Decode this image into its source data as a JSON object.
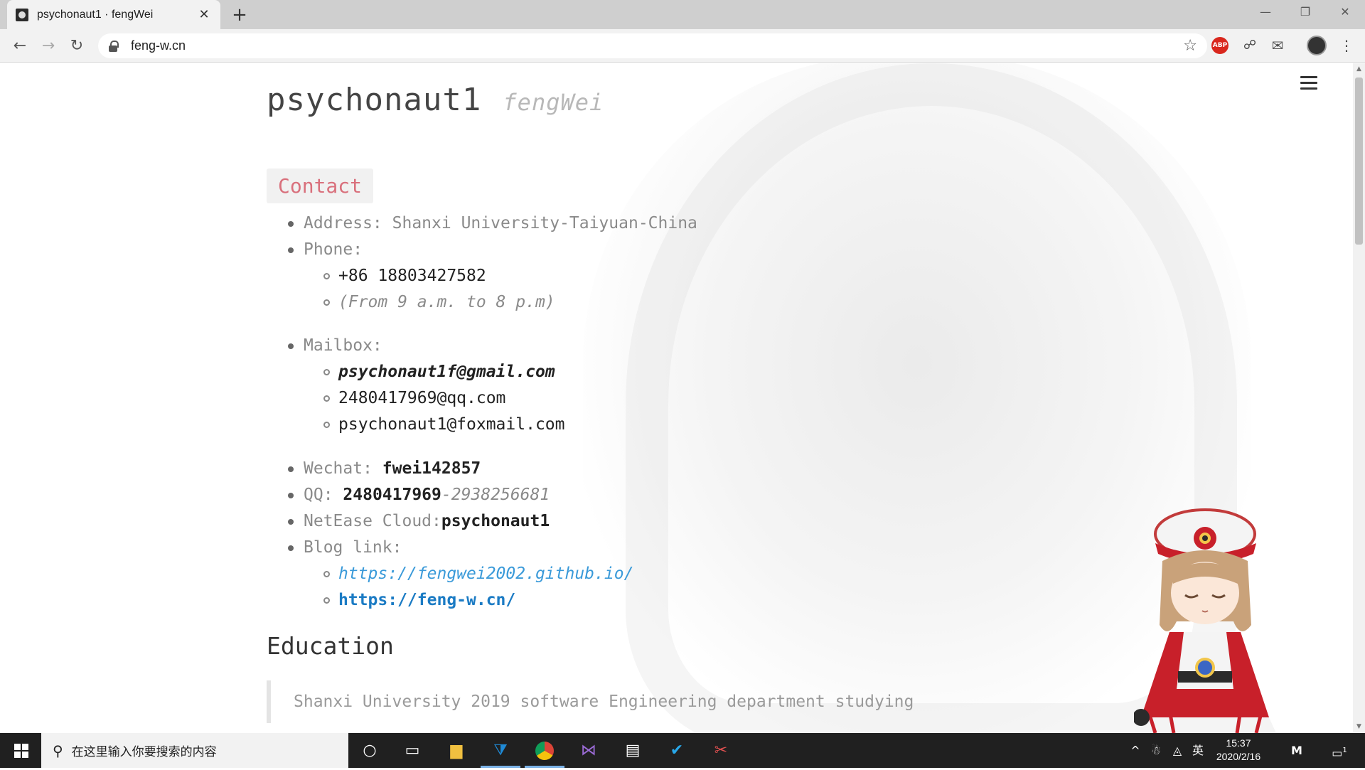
{
  "browser": {
    "tab_title": "psychonaut1 · fengWei",
    "tab_close": "✕",
    "new_tab": "+",
    "url": "feng-w.cn",
    "window_controls": {
      "minimize": "—",
      "restore": "❐",
      "close": "✕"
    },
    "extensions": {
      "abp_label": "ABP"
    }
  },
  "page": {
    "title": "psychonaut1",
    "subtitle": "fengWei",
    "contact_heading": "Contact",
    "address_label": "Address:",
    "address_value": "Shanxi University-Taiyuan-China",
    "phone_label": "Phone:",
    "phone_number": "+86 18803427582",
    "phone_hours": "(From 9 a.m. to 8 p.m)",
    "mailbox_label": "Mailbox:",
    "emails": [
      "psychonaut1f@gmail.com",
      "2480417969@qq.com",
      "psychonaut1@foxmail.com"
    ],
    "wechat_label": "Wechat:",
    "wechat_value": "fwei142857",
    "qq_label": "QQ:",
    "qq_value": "2480417969",
    "qq_alt": "-2938256681",
    "netease_label": "NetEase Cloud:",
    "netease_value": "psychonaut1",
    "blog_label": "Blog link:",
    "blog_links": [
      "https://fengwei2002.github.io/",
      "https://feng-w.cn/"
    ],
    "education_heading": "Education",
    "education_text": "Shanxi University 2019 software Engineering department studying"
  },
  "taskbar": {
    "search_placeholder": "在这里输入你要搜索的内容",
    "ime_label": "英",
    "time": "15:37",
    "date": "2020/2/16",
    "notification_count": "1"
  },
  "colors": {
    "accent_contact": "#d9707c",
    "link_italic": "#3a9ad9",
    "link_bold": "#1b7bc4",
    "taskbar_bg": "#202020"
  }
}
